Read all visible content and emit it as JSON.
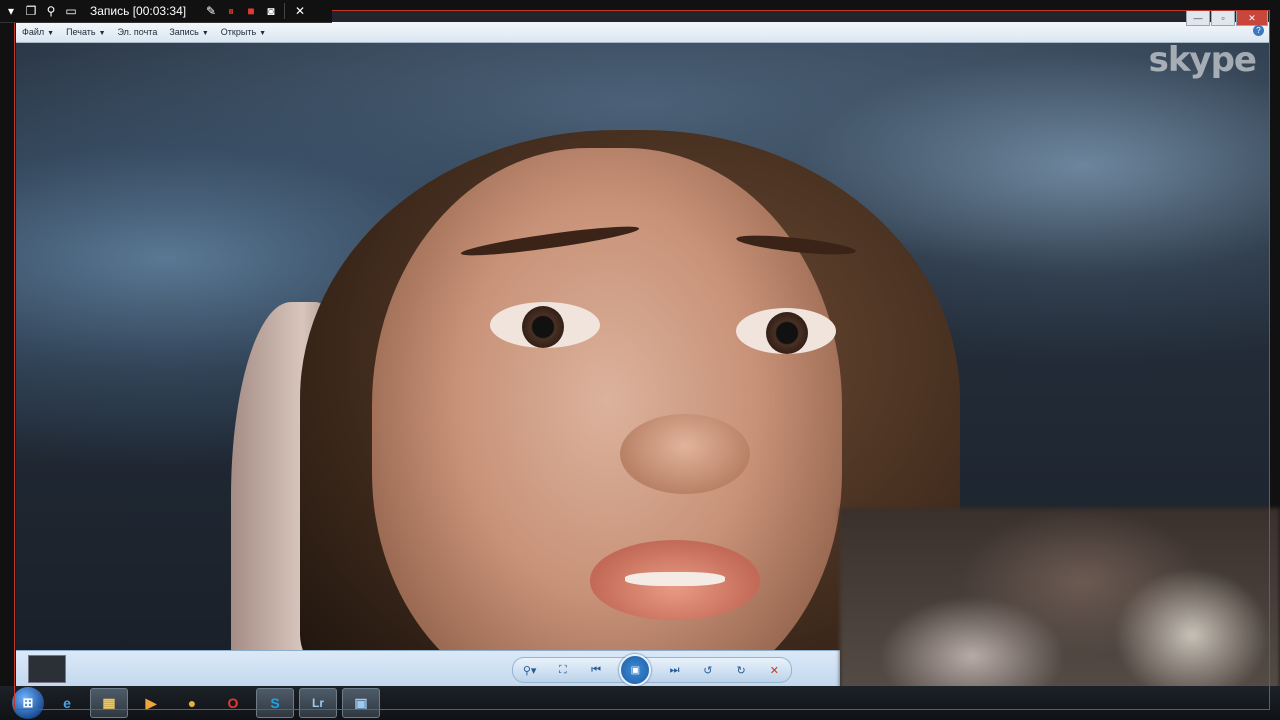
{
  "recorder": {
    "title": "Запись [00:03:34]"
  },
  "menu": {
    "items": [
      {
        "label": "Файл",
        "has_caret": true
      },
      {
        "label": "Печать",
        "has_caret": true
      },
      {
        "label": "Эл. почта",
        "has_caret": false
      },
      {
        "label": "Запись",
        "has_caret": true
      },
      {
        "label": "Открыть",
        "has_caret": true
      }
    ],
    "help_label": "?"
  },
  "watermark": {
    "text": "skype"
  },
  "taskbar": {
    "apps": [
      {
        "name": "ie-icon",
        "label": "e",
        "color": "#4aa3e8"
      },
      {
        "name": "explorer-icon",
        "label": "▦",
        "color": "#f1c75a"
      },
      {
        "name": "media-player-icon",
        "label": "▶",
        "color": "#f0a53a"
      },
      {
        "name": "chrome-icon",
        "label": "●",
        "color": "#e8b13a"
      },
      {
        "name": "opera-icon",
        "label": "O",
        "color": "#e53a2e"
      },
      {
        "name": "skype-icon",
        "label": "S",
        "color": "#1fa3e2"
      },
      {
        "name": "lightroom-icon",
        "label": "Lr",
        "color": "#9cc9f0"
      },
      {
        "name": "photo-viewer-icon",
        "label": "▣",
        "color": "#9cc9f0"
      }
    ]
  }
}
